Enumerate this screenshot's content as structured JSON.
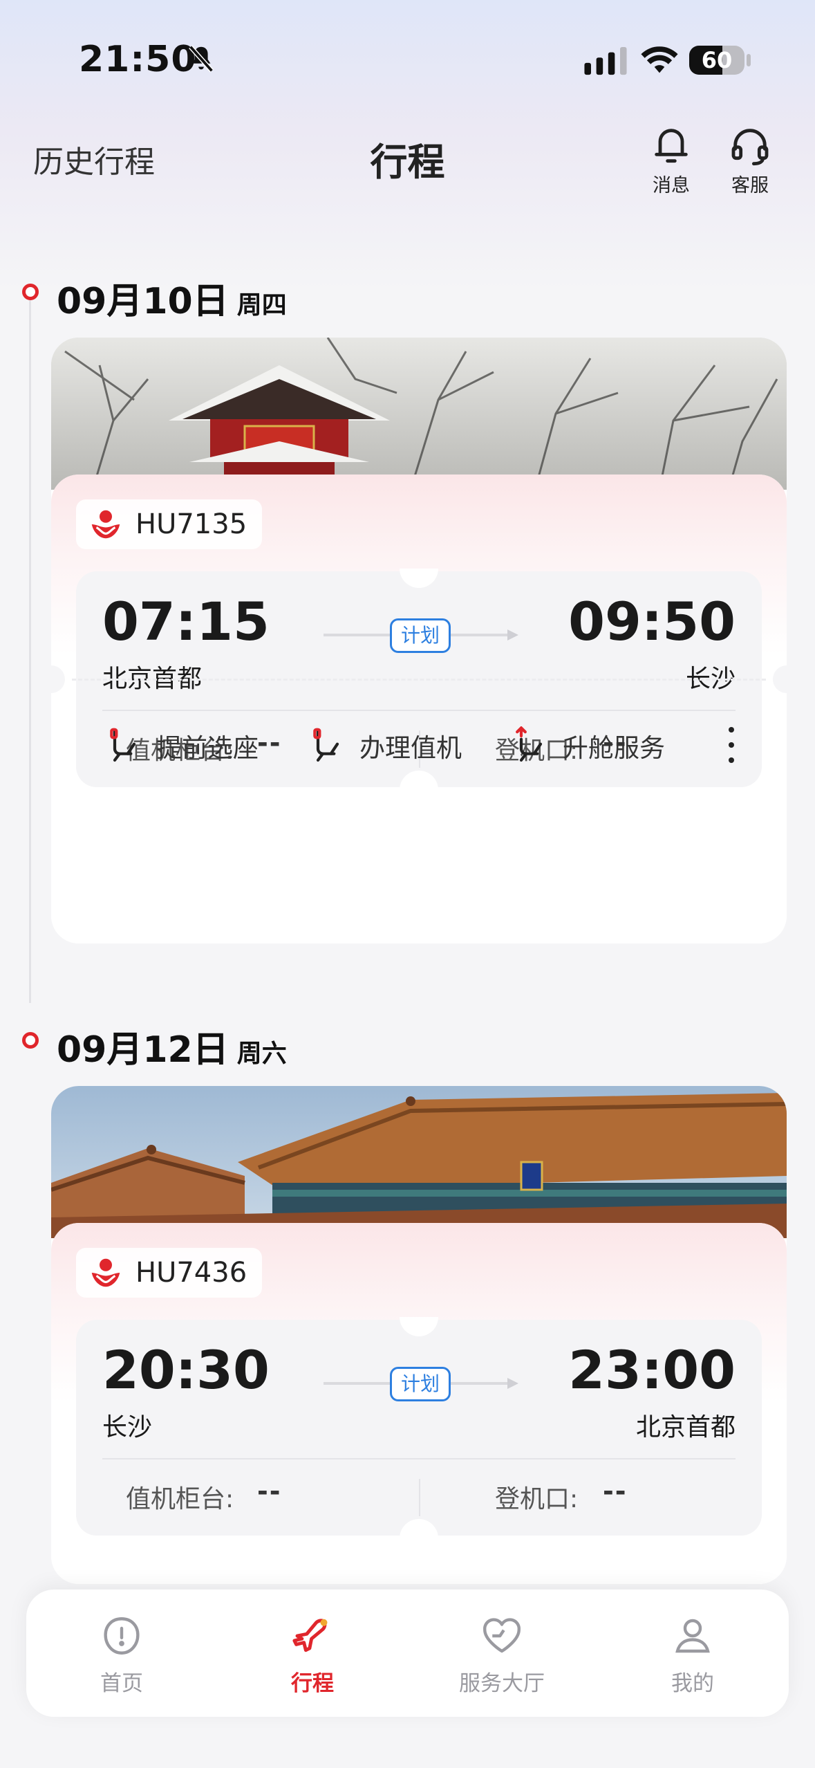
{
  "status_bar": {
    "time": "21:50",
    "battery_level": "60",
    "battery_fraction": 0.6,
    "icons": [
      "bell-off-icon",
      "signal-icon",
      "wifi-icon",
      "battery-icon"
    ]
  },
  "header": {
    "history_label": "历史行程",
    "title": "行程",
    "messages_label": "消息",
    "service_label": "客服"
  },
  "trips": [
    {
      "date": "09月10日",
      "weekday": "周四",
      "flight_no": "HU7135",
      "dep_time": "07:15",
      "arr_time": "09:50",
      "dep_city": "北京首都",
      "arr_city": "长沙",
      "status": "计划",
      "counter_label": "值机柜台:",
      "counter_value": "--",
      "gate_label": "登机口:",
      "gate_value": "--",
      "actions": [
        "提前选座",
        "办理值机",
        "升舱服务"
      ]
    },
    {
      "date": "09月12日",
      "weekday": "周六",
      "flight_no": "HU7436",
      "dep_time": "20:30",
      "arr_time": "23:00",
      "dep_city": "长沙",
      "arr_city": "北京首都",
      "status": "计划",
      "counter_label": "值机柜台:",
      "counter_value": "--",
      "gate_label": "登机口:",
      "gate_value": "--"
    }
  ],
  "tabbar": {
    "items": [
      {
        "label": "首页",
        "icon": "home-icon",
        "active": false
      },
      {
        "label": "行程",
        "icon": "plane-icon",
        "active": true
      },
      {
        "label": "服务大厅",
        "icon": "service-heart-icon",
        "active": false
      },
      {
        "label": "我的",
        "icon": "profile-icon",
        "active": false
      }
    ]
  },
  "colors": {
    "accent_red": "#e0262c",
    "status_blue": "#2d7fe0",
    "page_bg": "#f5f5f7"
  }
}
